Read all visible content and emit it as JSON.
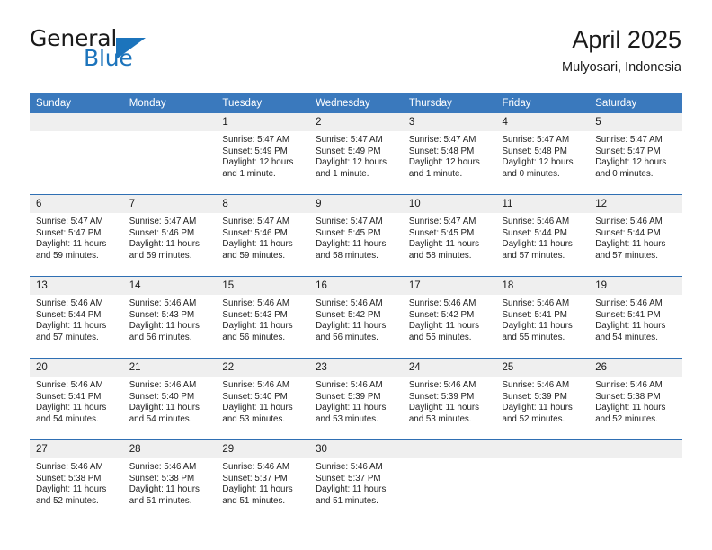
{
  "brand": {
    "name_part1": "General",
    "name_part2": "Blue",
    "logo_icon": "triangle-logo-icon",
    "accent_color": "#1c74bc"
  },
  "header": {
    "title": "April 2025",
    "subtitle": "Mulyosari, Indonesia"
  },
  "colors": {
    "header_row": "#3a79bd",
    "week_separator": "#2f6fb3",
    "daynum_band": "#efefef",
    "text": "#1a1a1a"
  },
  "calendar": {
    "weekday_headers": [
      "Sunday",
      "Monday",
      "Tuesday",
      "Wednesday",
      "Thursday",
      "Friday",
      "Saturday"
    ],
    "weeks": [
      [
        {
          "day": "",
          "empty": true,
          "sunrise": "",
          "sunset": "",
          "daylight": ""
        },
        {
          "day": "",
          "empty": true,
          "sunrise": "",
          "sunset": "",
          "daylight": ""
        },
        {
          "day": "1",
          "sunrise": "Sunrise: 5:47 AM",
          "sunset": "Sunset: 5:49 PM",
          "daylight": "Daylight: 12 hours and 1 minute."
        },
        {
          "day": "2",
          "sunrise": "Sunrise: 5:47 AM",
          "sunset": "Sunset: 5:49 PM",
          "daylight": "Daylight: 12 hours and 1 minute."
        },
        {
          "day": "3",
          "sunrise": "Sunrise: 5:47 AM",
          "sunset": "Sunset: 5:48 PM",
          "daylight": "Daylight: 12 hours and 1 minute."
        },
        {
          "day": "4",
          "sunrise": "Sunrise: 5:47 AM",
          "sunset": "Sunset: 5:48 PM",
          "daylight": "Daylight: 12 hours and 0 minutes."
        },
        {
          "day": "5",
          "sunrise": "Sunrise: 5:47 AM",
          "sunset": "Sunset: 5:47 PM",
          "daylight": "Daylight: 12 hours and 0 minutes."
        }
      ],
      [
        {
          "day": "6",
          "sunrise": "Sunrise: 5:47 AM",
          "sunset": "Sunset: 5:47 PM",
          "daylight": "Daylight: 11 hours and 59 minutes."
        },
        {
          "day": "7",
          "sunrise": "Sunrise: 5:47 AM",
          "sunset": "Sunset: 5:46 PM",
          "daylight": "Daylight: 11 hours and 59 minutes."
        },
        {
          "day": "8",
          "sunrise": "Sunrise: 5:47 AM",
          "sunset": "Sunset: 5:46 PM",
          "daylight": "Daylight: 11 hours and 59 minutes."
        },
        {
          "day": "9",
          "sunrise": "Sunrise: 5:47 AM",
          "sunset": "Sunset: 5:45 PM",
          "daylight": "Daylight: 11 hours and 58 minutes."
        },
        {
          "day": "10",
          "sunrise": "Sunrise: 5:47 AM",
          "sunset": "Sunset: 5:45 PM",
          "daylight": "Daylight: 11 hours and 58 minutes."
        },
        {
          "day": "11",
          "sunrise": "Sunrise: 5:46 AM",
          "sunset": "Sunset: 5:44 PM",
          "daylight": "Daylight: 11 hours and 57 minutes."
        },
        {
          "day": "12",
          "sunrise": "Sunrise: 5:46 AM",
          "sunset": "Sunset: 5:44 PM",
          "daylight": "Daylight: 11 hours and 57 minutes."
        }
      ],
      [
        {
          "day": "13",
          "sunrise": "Sunrise: 5:46 AM",
          "sunset": "Sunset: 5:44 PM",
          "daylight": "Daylight: 11 hours and 57 minutes."
        },
        {
          "day": "14",
          "sunrise": "Sunrise: 5:46 AM",
          "sunset": "Sunset: 5:43 PM",
          "daylight": "Daylight: 11 hours and 56 minutes."
        },
        {
          "day": "15",
          "sunrise": "Sunrise: 5:46 AM",
          "sunset": "Sunset: 5:43 PM",
          "daylight": "Daylight: 11 hours and 56 minutes."
        },
        {
          "day": "16",
          "sunrise": "Sunrise: 5:46 AM",
          "sunset": "Sunset: 5:42 PM",
          "daylight": "Daylight: 11 hours and 56 minutes."
        },
        {
          "day": "17",
          "sunrise": "Sunrise: 5:46 AM",
          "sunset": "Sunset: 5:42 PM",
          "daylight": "Daylight: 11 hours and 55 minutes."
        },
        {
          "day": "18",
          "sunrise": "Sunrise: 5:46 AM",
          "sunset": "Sunset: 5:41 PM",
          "daylight": "Daylight: 11 hours and 55 minutes."
        },
        {
          "day": "19",
          "sunrise": "Sunrise: 5:46 AM",
          "sunset": "Sunset: 5:41 PM",
          "daylight": "Daylight: 11 hours and 54 minutes."
        }
      ],
      [
        {
          "day": "20",
          "sunrise": "Sunrise: 5:46 AM",
          "sunset": "Sunset: 5:41 PM",
          "daylight": "Daylight: 11 hours and 54 minutes."
        },
        {
          "day": "21",
          "sunrise": "Sunrise: 5:46 AM",
          "sunset": "Sunset: 5:40 PM",
          "daylight": "Daylight: 11 hours and 54 minutes."
        },
        {
          "day": "22",
          "sunrise": "Sunrise: 5:46 AM",
          "sunset": "Sunset: 5:40 PM",
          "daylight": "Daylight: 11 hours and 53 minutes."
        },
        {
          "day": "23",
          "sunrise": "Sunrise: 5:46 AM",
          "sunset": "Sunset: 5:39 PM",
          "daylight": "Daylight: 11 hours and 53 minutes."
        },
        {
          "day": "24",
          "sunrise": "Sunrise: 5:46 AM",
          "sunset": "Sunset: 5:39 PM",
          "daylight": "Daylight: 11 hours and 53 minutes."
        },
        {
          "day": "25",
          "sunrise": "Sunrise: 5:46 AM",
          "sunset": "Sunset: 5:39 PM",
          "daylight": "Daylight: 11 hours and 52 minutes."
        },
        {
          "day": "26",
          "sunrise": "Sunrise: 5:46 AM",
          "sunset": "Sunset: 5:38 PM",
          "daylight": "Daylight: 11 hours and 52 minutes."
        }
      ],
      [
        {
          "day": "27",
          "sunrise": "Sunrise: 5:46 AM",
          "sunset": "Sunset: 5:38 PM",
          "daylight": "Daylight: 11 hours and 52 minutes."
        },
        {
          "day": "28",
          "sunrise": "Sunrise: 5:46 AM",
          "sunset": "Sunset: 5:38 PM",
          "daylight": "Daylight: 11 hours and 51 minutes."
        },
        {
          "day": "29",
          "sunrise": "Sunrise: 5:46 AM",
          "sunset": "Sunset: 5:37 PM",
          "daylight": "Daylight: 11 hours and 51 minutes."
        },
        {
          "day": "30",
          "sunrise": "Sunrise: 5:46 AM",
          "sunset": "Sunset: 5:37 PM",
          "daylight": "Daylight: 11 hours and 51 minutes."
        },
        {
          "day": "",
          "empty": true,
          "sunrise": "",
          "sunset": "",
          "daylight": ""
        },
        {
          "day": "",
          "empty": true,
          "sunrise": "",
          "sunset": "",
          "daylight": ""
        },
        {
          "day": "",
          "empty": true,
          "sunrise": "",
          "sunset": "",
          "daylight": ""
        }
      ]
    ]
  }
}
